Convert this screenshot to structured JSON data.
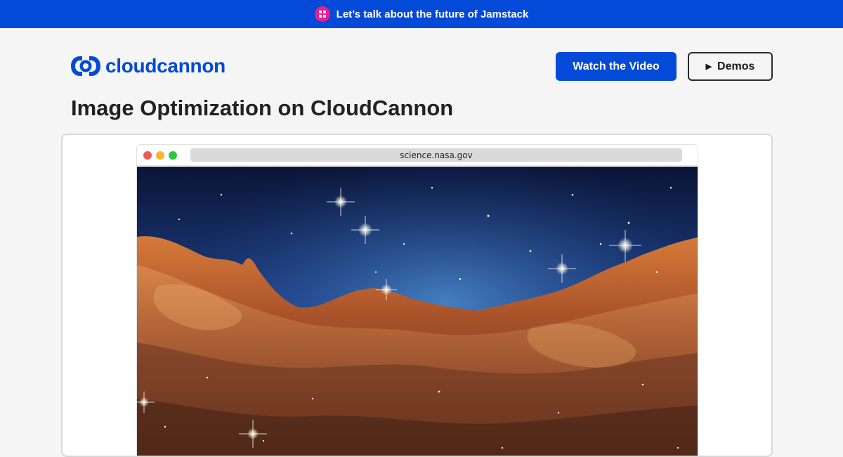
{
  "announcement": {
    "text": "Let’s talk about the future of Jamstack",
    "icon": "jamstack-badge-icon",
    "colors": {
      "background": "#034ad8",
      "badge": "#e91e8c"
    }
  },
  "header": {
    "logo_text": "cloudcannon",
    "logo_icon": "cloudcannon-logo-icon",
    "brand_color": "#034ad8",
    "watch_button_label": "Watch the Video",
    "demos_button_label": "Demos",
    "demos_button_icon": "play-icon"
  },
  "main": {
    "title": "Image Optimization on CloudCannon"
  },
  "browser": {
    "url": "science.nasa.gov",
    "traffic_lights": [
      "#ee5c54",
      "#f6b72b",
      "#2ec840"
    ],
    "image_description_icon": "nebula-image"
  }
}
